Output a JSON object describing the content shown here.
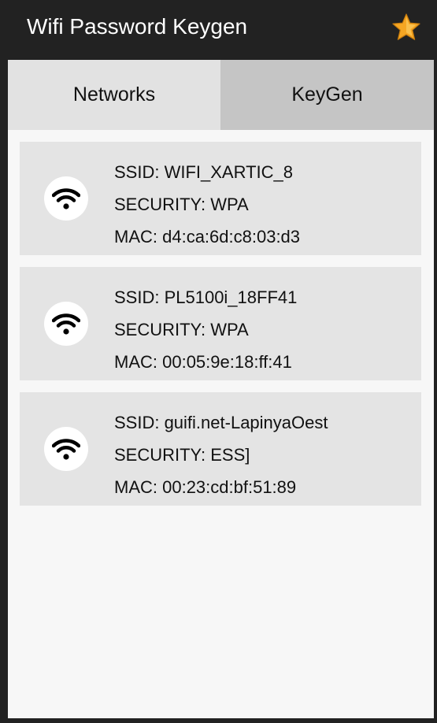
{
  "app": {
    "title": "Wifi Password Keygen",
    "star_icon": "star-icon",
    "accent_color": "#f5a623"
  },
  "tabs": [
    {
      "label": "Networks",
      "selected": true
    },
    {
      "label": "KeyGen",
      "selected": false
    }
  ],
  "networks": [
    {
      "icon": "wifi-icon",
      "ssid": "SSID: WIFI_XARTIC_8",
      "security": "SECURITY: WPA",
      "mac": "MAC: d4:ca:6d:c8:03:d3"
    },
    {
      "icon": "wifi-icon",
      "ssid": "SSID: PL5100i_18FF41",
      "security": "SECURITY: WPA",
      "mac": "MAC: 00:05:9e:18:ff:41"
    },
    {
      "icon": "wifi-icon",
      "ssid": "SSID: guifi.net-LapinyaOest",
      "security": "SECURITY: ESS]",
      "mac": "MAC: 00:23:cd:bf:51:89"
    }
  ]
}
